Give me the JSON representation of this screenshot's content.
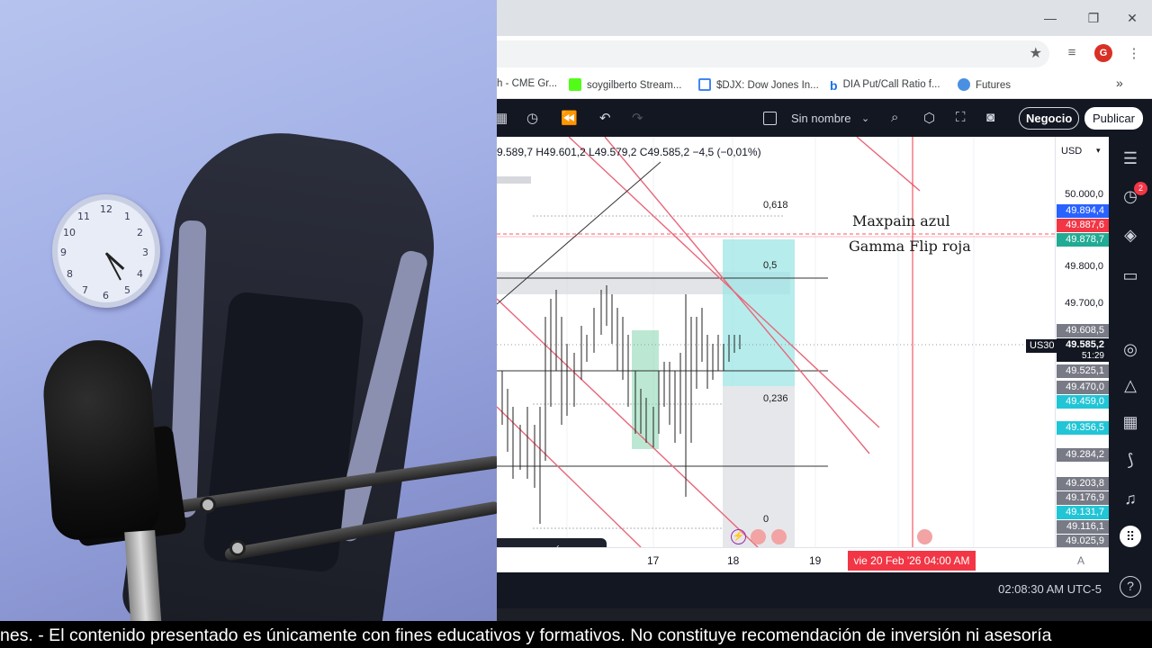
{
  "browser": {
    "bookmarks": [
      {
        "label": "h - CME Gr...",
        "icon": "cme-icon"
      },
      {
        "label": "soygilberto Stream...",
        "icon": "kick-icon",
        "color": "#53fc18"
      },
      {
        "label": "$DJX: Dow Jones In...",
        "icon": "djx-icon"
      },
      {
        "label": "DIA Put/Call Ratio f...",
        "icon": "barchart-b-icon"
      },
      {
        "label": "Futures",
        "icon": "futures-icon"
      }
    ],
    "avatar_letter": "G"
  },
  "tradingview": {
    "layout_name": "Sin nombre",
    "negocio_label": "Negocio",
    "publicar_label": "Publicar",
    "ohlc": "9.589,7  H49.601,2  L49.579,2  C49.585,2  −4,5  (−0,01%)",
    "currency": "USD",
    "symbol_tag": "US30",
    "alerts_badge": "2",
    "clock": "02:08:30 AM UTC-5",
    "time_labels": [
      "17",
      "18",
      "19"
    ],
    "time_cursor": "vie 20 Feb '26   04:00 AM",
    "auto_label": "A",
    "fib_levels": [
      "0,618",
      "0,5",
      "0,236",
      "0"
    ],
    "annotations": {
      "maxpain": "Maxpain azul",
      "gamma": "Gamma Flip roja"
    },
    "price_ticks": [
      "50.000,0",
      "49.800,0",
      "49.700,0"
    ],
    "price_tags": [
      {
        "label": "49.894,4",
        "color": "#2962ff"
      },
      {
        "label": "49.887,6",
        "color": "#f23645"
      },
      {
        "label": "49.878,7",
        "color": "#22ab94"
      },
      {
        "label": "49.608,5",
        "color": "#787b86"
      },
      {
        "label": "49.585,2",
        "color": "#131722"
      },
      {
        "label": "51:29",
        "color": "#131722"
      },
      {
        "label": "49.525,1",
        "color": "#787b86"
      },
      {
        "label": "49.470,0",
        "color": "#787b86"
      },
      {
        "label": "49.459,0",
        "color": "#22c5d6"
      },
      {
        "label": "49.356,5",
        "color": "#22c5d6"
      },
      {
        "label": "49.284,2",
        "color": "#787b86"
      },
      {
        "label": "49.203,8",
        "color": "#787b86"
      },
      {
        "label": "49.176,9",
        "color": "#787b86"
      },
      {
        "label": "49.131,7",
        "color": "#22c5d6"
      },
      {
        "label": "49.116,1",
        "color": "#787b86"
      },
      {
        "label": "49.025,9",
        "color": "#787b86"
      }
    ]
  },
  "ticker": {
    "text": "nes.  - El contenido presentado es únicamente con fines educativos y formativos. No constituye recomendación de inversión ni asesoría"
  }
}
